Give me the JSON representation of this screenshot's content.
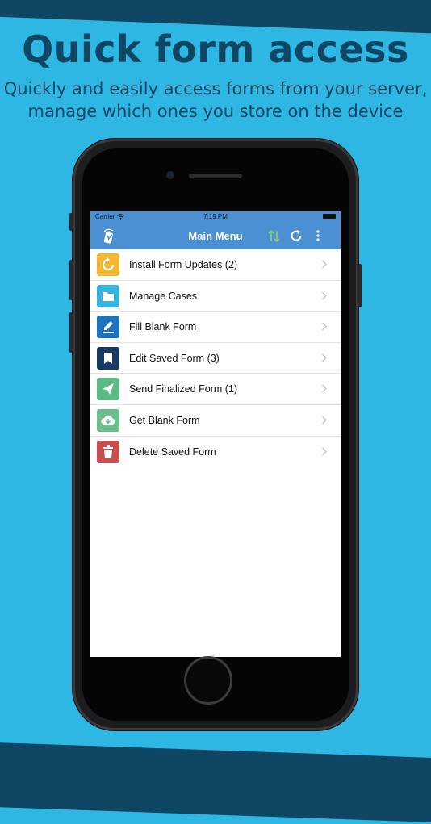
{
  "headline": "Quick form access",
  "subline": {
    "line1": "Quickly and easily access forms from your server,",
    "line2": "manage which ones you store on the device"
  },
  "status_bar": {
    "carrier": "Carrier",
    "time": "7:19 PM"
  },
  "nav": {
    "title": "Main Menu"
  },
  "menu": [
    {
      "label": "Install Form Updates (2)",
      "icon": "update-icon",
      "color": "#f2b632"
    },
    {
      "label": "Manage Cases",
      "icon": "folder-icon",
      "color": "#35b3e3"
    },
    {
      "label": "Fill Blank Form",
      "icon": "pencil-icon",
      "color": "#1e73be"
    },
    {
      "label": "Edit Saved Form (3)",
      "icon": "bookmark-icon",
      "color": "#163a63"
    },
    {
      "label": "Send Finalized Form (1)",
      "icon": "send-icon",
      "color": "#5cba86"
    },
    {
      "label": "Get Blank Form",
      "icon": "download-cloud-icon",
      "color": "#6bbf8e"
    },
    {
      "label": "Delete Saved Form",
      "icon": "trash-icon",
      "color": "#c94e4e"
    }
  ],
  "colors": {
    "background": "#2fb7e4",
    "navbar": "#4a90d2",
    "headline": "#0f4663"
  }
}
